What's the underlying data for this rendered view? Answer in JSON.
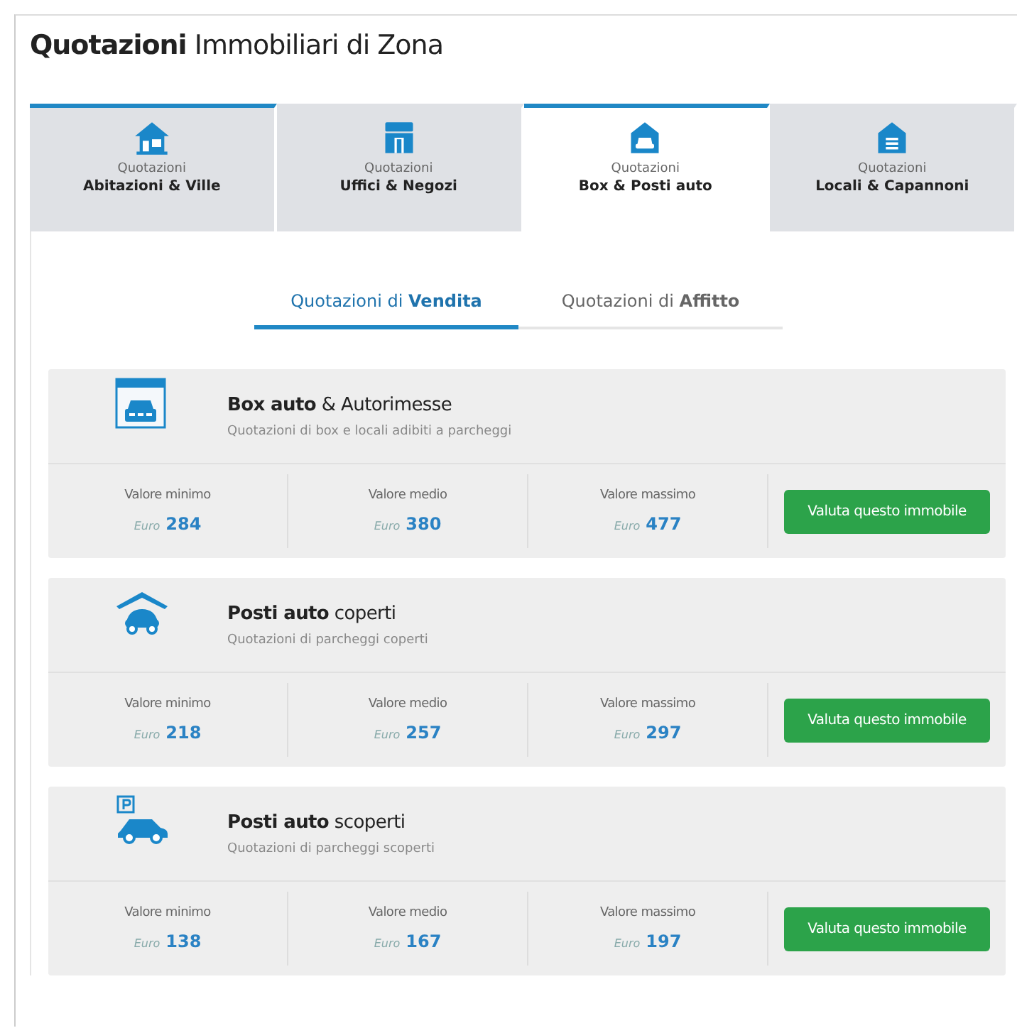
{
  "title": "**Quotazioni** Immobiliari di Zona",
  "tabs": [
    {
      "kind": "house",
      "caption": "Quotazioni",
      "label": "Abitazioni & Ville",
      "selected": false,
      "highlighted": true
    },
    {
      "kind": "shop",
      "caption": "Quotazioni",
      "label": "Uffici & Negozi",
      "selected": false,
      "highlighted": false
    },
    {
      "kind": "garage",
      "caption": "Quotazioni",
      "label": "Box & Posti auto",
      "selected": true,
      "highlighted": true
    },
    {
      "kind": "warehouse",
      "caption": "Quotazioni",
      "label": "Locali & Capannoni",
      "selected": false,
      "highlighted": false
    }
  ],
  "subtabs": [
    {
      "label": "Quotazioni di **Vendita**",
      "selected": true
    },
    {
      "label": "Quotazioni di **Affitto**",
      "selected": false
    }
  ],
  "categories": [
    {
      "kind": "box",
      "title": "**Box auto** & Autorimesse",
      "subtitle": "Quotazioni di box e locali adibiti a parcheggi",
      "stats": [
        {
          "label": "Valore minimo",
          "currency": "Euro",
          "value": "284"
        },
        {
          "label": "Valore medio",
          "currency": "Euro",
          "value": "380"
        },
        {
          "label": "Valore massimo",
          "currency": "Euro",
          "value": "477"
        }
      ],
      "button": "Valuta questo immobile"
    },
    {
      "kind": "covered",
      "title": "**Posti auto** coperti",
      "subtitle": "Quotazioni di parcheggi coperti",
      "stats": [
        {
          "label": "Valore minimo",
          "currency": "Euro",
          "value": "218"
        },
        {
          "label": "Valore medio",
          "currency": "Euro",
          "value": "257"
        },
        {
          "label": "Valore massimo",
          "currency": "Euro",
          "value": "297"
        }
      ],
      "button": "Valuta questo immobile"
    },
    {
      "kind": "open",
      "title": "**Posti auto** scoperti",
      "subtitle": "Quotazioni di parcheggi scoperti",
      "stats": [
        {
          "label": "Valore minimo",
          "currency": "Euro",
          "value": "138"
        },
        {
          "label": "Valore medio",
          "currency": "Euro",
          "value": "167"
        },
        {
          "label": "Valore massimo",
          "currency": "Euro",
          "value": "197"
        }
      ],
      "button": "Valuta questo immobile"
    }
  ]
}
